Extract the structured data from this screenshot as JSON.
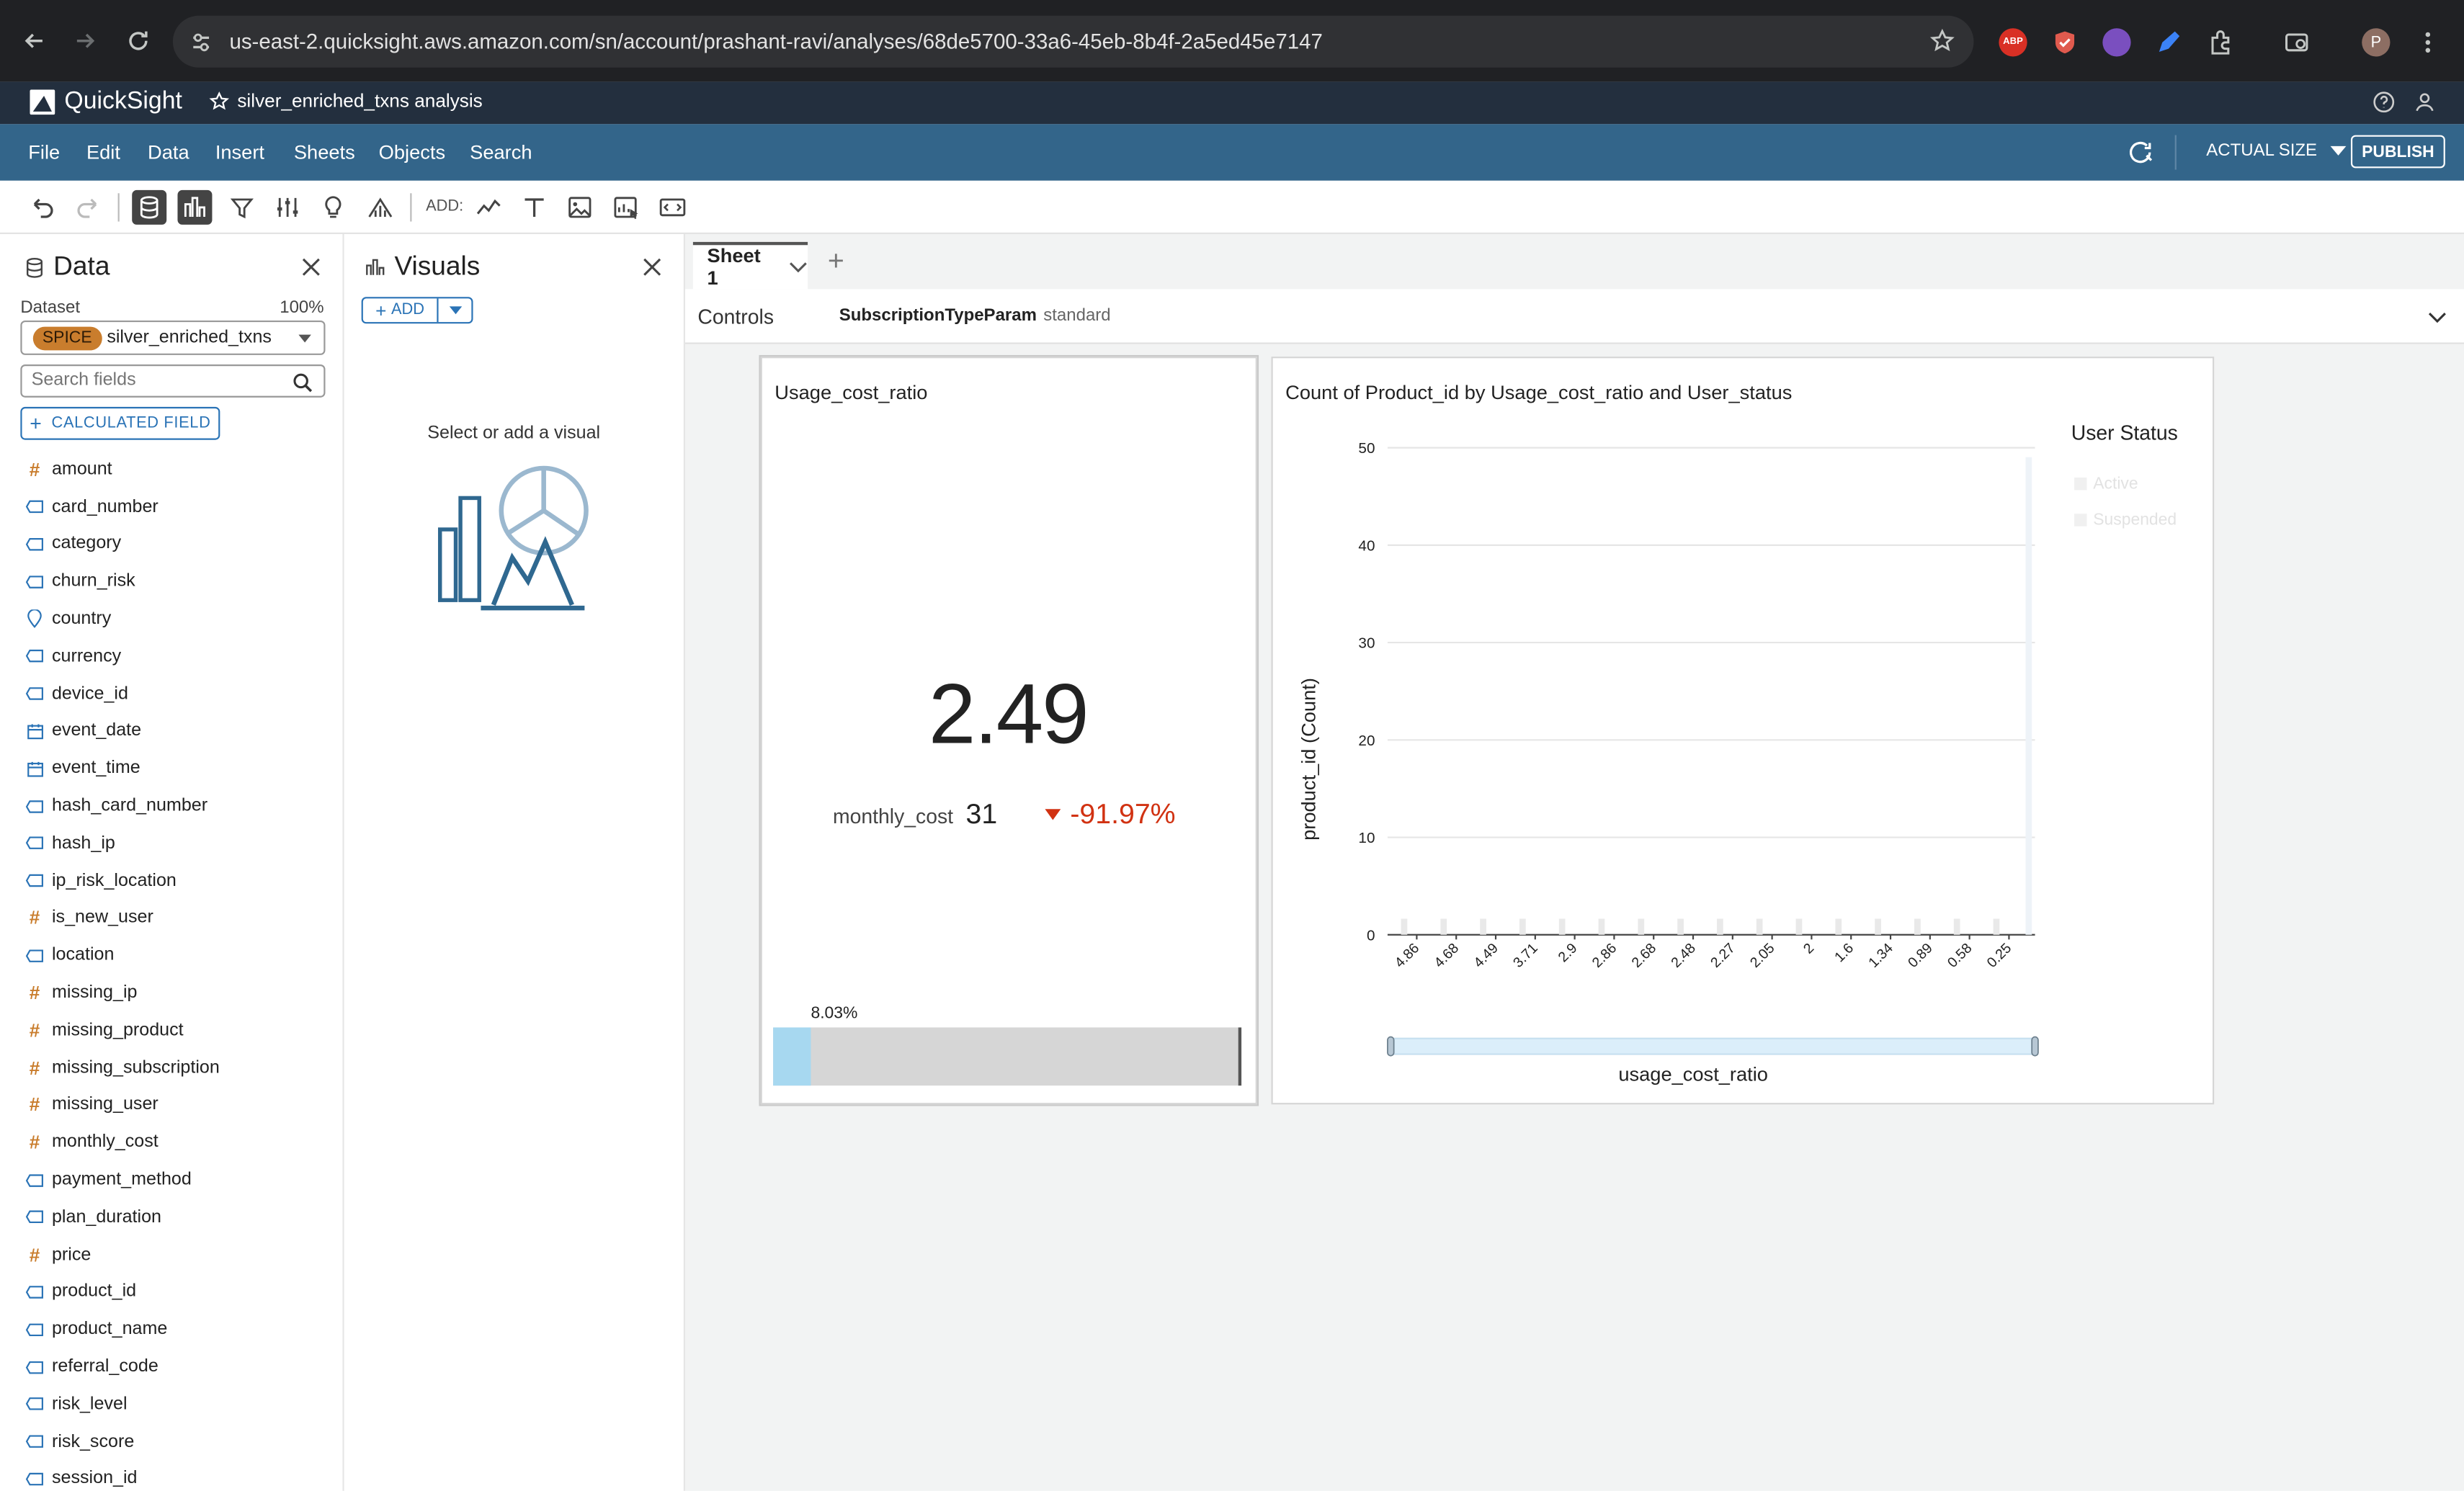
{
  "browser": {
    "url": "us-east-2.quicksight.aws.amazon.com/sn/account/prashant-ravi/analyses/68de5700-33a6-45eb-8b4f-2a5ed45e7147",
    "profile_initial": "P",
    "ext_abp": "ABP"
  },
  "app": {
    "name": "QuickSight",
    "analysis_name": "silver_enriched_txns analysis"
  },
  "menu": {
    "items": [
      "File",
      "Edit",
      "Data",
      "Insert",
      "Sheets",
      "Objects",
      "Search"
    ],
    "actual_size": "ACTUAL SIZE",
    "publish": "PUBLISH"
  },
  "toolbar": {
    "add_label": "ADD:"
  },
  "data_panel": {
    "title": "Data",
    "dataset_label": "Dataset",
    "dataset_pct": "100%",
    "spice_badge": "SPICE",
    "dataset_name": "silver_enriched_txns",
    "search_placeholder": "Search fields",
    "calculated_field": "CALCULATED FIELD",
    "fields": [
      {
        "name": "amount",
        "type": "measure"
      },
      {
        "name": "card_number",
        "type": "dimension"
      },
      {
        "name": "category",
        "type": "dimension"
      },
      {
        "name": "churn_risk",
        "type": "dimension"
      },
      {
        "name": "country",
        "type": "geo"
      },
      {
        "name": "currency",
        "type": "dimension"
      },
      {
        "name": "device_id",
        "type": "dimension"
      },
      {
        "name": "event_date",
        "type": "date"
      },
      {
        "name": "event_time",
        "type": "date"
      },
      {
        "name": "hash_card_number",
        "type": "dimension"
      },
      {
        "name": "hash_ip",
        "type": "dimension"
      },
      {
        "name": "ip_risk_location",
        "type": "dimension"
      },
      {
        "name": "is_new_user",
        "type": "measure"
      },
      {
        "name": "location",
        "type": "dimension"
      },
      {
        "name": "missing_ip",
        "type": "measure"
      },
      {
        "name": "missing_product",
        "type": "measure"
      },
      {
        "name": "missing_subscription",
        "type": "measure"
      },
      {
        "name": "missing_user",
        "type": "measure"
      },
      {
        "name": "monthly_cost",
        "type": "measure"
      },
      {
        "name": "payment_method",
        "type": "dimension"
      },
      {
        "name": "plan_duration",
        "type": "dimension"
      },
      {
        "name": "price",
        "type": "measure"
      },
      {
        "name": "product_id",
        "type": "dimension"
      },
      {
        "name": "product_name",
        "type": "dimension"
      },
      {
        "name": "referral_code",
        "type": "dimension"
      },
      {
        "name": "risk_level",
        "type": "dimension"
      },
      {
        "name": "risk_score",
        "type": "dimension"
      },
      {
        "name": "session_id",
        "type": "dimension"
      }
    ]
  },
  "visuals_panel": {
    "title": "Visuals",
    "add_label": "ADD",
    "empty_text": "Select or add a visual"
  },
  "sheet": {
    "tab_label": "Sheet 1",
    "controls_label": "Controls",
    "param_name": "SubscriptionTypeParam",
    "param_value": "standard"
  },
  "kpi": {
    "title": "Usage_cost_ratio",
    "value": "2.49",
    "compare_label": "monthly_cost",
    "compare_value": "31",
    "delta": "-91.97%",
    "progress_label": "8.03%",
    "progress_fraction": 0.0803,
    "delta_color": "#d13212"
  },
  "chart_data": {
    "type": "bar",
    "title": "Count of Product_id by Usage_cost_ratio and User_status",
    "xlabel": "usage_cost_ratio",
    "ylabel": "product_id (Count)",
    "ylim": [
      0,
      50
    ],
    "yticks": [
      0,
      10,
      20,
      30,
      40,
      50
    ],
    "categories": [
      "4.86",
      "4.68",
      "4.49",
      "3.71",
      "2.9",
      "2.86",
      "2.68",
      "2.48",
      "2.27",
      "2.05",
      "2",
      "1.6",
      "1.34",
      "0.89",
      "0.58",
      "0.25"
    ],
    "series": [
      {
        "name": "Active",
        "values": [
          1,
          1,
          1,
          1,
          1,
          1,
          1,
          1,
          1,
          1,
          1,
          1,
          1,
          1,
          1,
          1
        ]
      },
      {
        "name": "Suspended",
        "values": [
          0,
          0,
          0,
          0,
          0,
          0,
          0,
          0,
          0,
          0,
          0,
          0,
          0,
          0,
          0,
          0
        ]
      }
    ],
    "legend_title": "User Status",
    "legend_position": "right",
    "grid": true
  }
}
